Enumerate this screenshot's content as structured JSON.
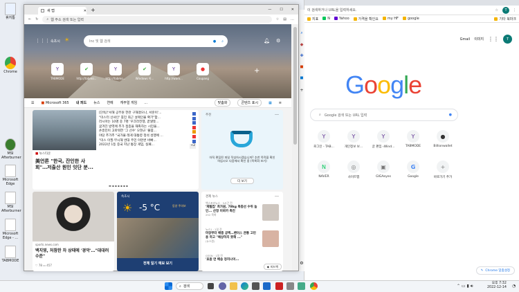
{
  "desktop": {
    "icons": [
      {
        "label": "휴지통"
      },
      {
        "label": "Chrome"
      },
      {
        "label": "MSI Afterburner"
      },
      {
        "label": "Microsoft Edge"
      },
      {
        "label": "MSI Afterburner"
      },
      {
        "label": "Microsoft Edge - ..."
      },
      {
        "label": "TABMODE"
      }
    ]
  },
  "chrome": {
    "omnibox_placeholder": "이 검색하거나 URL을 입력하세요.",
    "avatar": "T",
    "bookmarks": [
      "지표",
      "N",
      "Yahoo",
      "가격을 확인요",
      "my HF",
      "google",
      "기타 북마크"
    ],
    "header_links": [
      "Gmail",
      "이미지"
    ],
    "logo": [
      "G",
      "o",
      "o",
      "g",
      "l",
      "e"
    ],
    "logo_colors": [
      "#4285f4",
      "#ea4335",
      "#fbbc05",
      "#4285f4",
      "#34a853",
      "#ea4335"
    ],
    "search_placeholder": "Google 검색 또는 URL 입력",
    "shortcuts": [
      {
        "label": "로그인 - TAB...",
        "icon": "Y"
      },
      {
        "label": "개인정보 보...",
        "icon": "Y"
      },
      {
        "label": "글 편집 ‹Wind...",
        "icon": "Y"
      },
      {
        "label": "TABMODE",
        "icon": "Y"
      },
      {
        "label": "Billionwallet",
        "icon": "●"
      },
      {
        "label": "NAVER",
        "icon": "N"
      },
      {
        "label": "사이트맵",
        "icon": "◎"
      },
      {
        "label": "GIGAeyes",
        "icon": "▣"
      },
      {
        "label": "Google",
        "icon": "G"
      },
      {
        "label": "바로가기 추가",
        "icon": "+"
      }
    ],
    "customize_button": "Chrome 맞춤설정"
  },
  "edge": {
    "tab_title": "새 탭",
    "address_placeholder": "웹 주소 검색 또는 입력",
    "hero_location": "속초시",
    "hero_search_placeholder": "Inc 및 웹 검색",
    "quick_links": [
      {
        "label": "TABMODE",
        "icon": "Y"
      },
      {
        "label": "http://tabmo...",
        "icon": "✔"
      },
      {
        "label": "http://tabmo...",
        "icon": "Y"
      },
      {
        "label": "Windows 이...",
        "icon": "✔"
      },
      {
        "label": "http://waro...",
        "icon": "Y"
      },
      {
        "label": "Coupang",
        "icon": "●"
      }
    ],
    "nav": [
      "Microsoft 365",
      "내 피드",
      "뉴스",
      "연예",
      "캐주얼 게임"
    ],
    "nav_right": [
      "맞춤화",
      "콘텐츠 표시"
    ],
    "headline_source": "뉴스타운",
    "headline": "美언론 \"한국, 잔인한 사회\"…저출산 원인 잇단 분...",
    "news_list": [
      "[단독]\"서해 공무원 한관 구해졌으나, 서훈이'...",
      "\"미스터 선샤인' 휴민 최근 설렉인물 확기\"함...",
      "러시아는 10명 중 7명 '우크라전쟁, 끝낼뜻...",
      "굶겨진 방역에 추가 접종을 재촉하는 시민을...",
      "손흥민이 고마워한 '그 선수' 오현규 '볼땀...",
      "야당 추가추 \"국가물 레게 대통령 정석 성행에 ...",
      "\"미스 이필·무시해 번대 주민 이런번 바빠...",
      "2022년 1등 중국 지난 통장 게임, 실패..."
    ],
    "news_more": "+2",
    "ad_title": "추천",
    "ad_desc": "아직 편집된 파일 작성하시겠습니까? 추천 목적을 확인하십시오 다음에서 확인 중 (목록화 보기)",
    "ad_button": "더 보기",
    "photo_source": "sports.news.com",
    "photo_headline": "백지영, 처참한 차 상태에 '경악'…\"대대러 수준\"",
    "photo_stats": [
      "78",
      "457"
    ],
    "weather_city": "속초시",
    "weather_temp": "-5 °C",
    "weather_alert": "동양 주의보",
    "weather_footer": "전체 일기 예보 보기",
    "stories_title": "경제 뉴스",
    "stories": [
      {
        "source": "백스포츠뉴스 · 5시간 전",
        "title": "'재벌집' 최가원, 78kg 복종선 수위 높인... 산정 이바카 촉진",
        "stat": "252 목록"
      },
      {
        "source": "뉴스1 · 1일 전",
        "title": "마장부터 배중 공백…밴이스 관통 고민용 하고 \"예상하지 못해 ...\"",
        "stat": "(뉴스원)"
      },
      {
        "source": "GSSN · 1일 전",
        "title": "'효원 연 배송 정치나이...",
        "stat": ""
      }
    ],
    "feedback": "피드백"
  },
  "taskbar": {
    "search": "검색",
    "time": "오후 7:32",
    "date": "2022-12-14"
  }
}
